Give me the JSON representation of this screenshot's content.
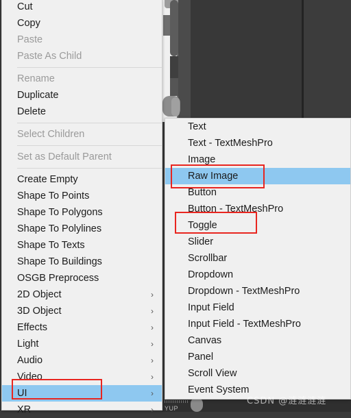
{
  "app": {
    "context": "unity-hierarchy-context-menu",
    "watermark": "CSDN @涟涟涟涟"
  },
  "colors": {
    "menu_background": "#f0f0f0",
    "menu_text": "#1b1b1b",
    "menu_text_disabled": "#9a9a9a",
    "highlight": "#8ec8f0",
    "annotation_red": "#e8251f",
    "editor_background": "#3a3a3a",
    "separator": "#d7d7d7"
  },
  "main_menu": {
    "name": "hierarchy-context-menu",
    "groups": [
      {
        "items": [
          {
            "label": "Cut",
            "enabled": true,
            "submenu": false
          },
          {
            "label": "Copy",
            "enabled": true,
            "submenu": false
          },
          {
            "label": "Paste",
            "enabled": false,
            "submenu": false
          },
          {
            "label": "Paste As Child",
            "enabled": false,
            "submenu": false
          }
        ]
      },
      {
        "items": [
          {
            "label": "Rename",
            "enabled": false,
            "submenu": false
          },
          {
            "label": "Duplicate",
            "enabled": true,
            "submenu": false
          },
          {
            "label": "Delete",
            "enabled": true,
            "submenu": false
          }
        ]
      },
      {
        "items": [
          {
            "label": "Select Children",
            "enabled": false,
            "submenu": false
          }
        ]
      },
      {
        "items": [
          {
            "label": "Set as Default Parent",
            "enabled": false,
            "submenu": false
          }
        ]
      },
      {
        "items": [
          {
            "label": "Create Empty",
            "enabled": true,
            "submenu": false
          },
          {
            "label": "Shape To Points",
            "enabled": true,
            "submenu": false
          },
          {
            "label": "Shape To Polygons",
            "enabled": true,
            "submenu": false
          },
          {
            "label": "Shape To Polylines",
            "enabled": true,
            "submenu": false
          },
          {
            "label": "Shape To Texts",
            "enabled": true,
            "submenu": false
          },
          {
            "label": "Shape To Buildings",
            "enabled": true,
            "submenu": false
          },
          {
            "label": "OSGB Preprocess",
            "enabled": true,
            "submenu": false
          },
          {
            "label": "2D Object",
            "enabled": true,
            "submenu": true
          },
          {
            "label": "3D Object",
            "enabled": true,
            "submenu": true
          },
          {
            "label": "Effects",
            "enabled": true,
            "submenu": true
          },
          {
            "label": "Light",
            "enabled": true,
            "submenu": true
          },
          {
            "label": "Audio",
            "enabled": true,
            "submenu": true
          },
          {
            "label": "Video",
            "enabled": true,
            "submenu": true
          },
          {
            "label": "UI",
            "enabled": true,
            "submenu": true,
            "selected": true
          },
          {
            "label": "XR",
            "enabled": true,
            "submenu": true
          }
        ]
      }
    ]
  },
  "sub_menu": {
    "name": "ui-submenu",
    "items": [
      {
        "label": "Text",
        "selected": false
      },
      {
        "label": "Text - TextMeshPro",
        "selected": false
      },
      {
        "label": "Image",
        "selected": false
      },
      {
        "label": "Raw Image",
        "selected": true
      },
      {
        "label": "Button",
        "selected": false
      },
      {
        "label": "Button - TextMeshPro",
        "selected": false
      },
      {
        "label": "Toggle",
        "selected": false
      },
      {
        "label": "Slider",
        "selected": false
      },
      {
        "label": "Scrollbar",
        "selected": false
      },
      {
        "label": "Dropdown",
        "selected": false
      },
      {
        "label": "Dropdown - TextMeshPro",
        "selected": false
      },
      {
        "label": "Input Field",
        "selected": false
      },
      {
        "label": "Input Field - TextMeshPro",
        "selected": false
      },
      {
        "label": "Canvas",
        "selected": false
      },
      {
        "label": "Panel",
        "selected": false
      },
      {
        "label": "Scroll View",
        "selected": false
      },
      {
        "label": "Event System",
        "selected": false
      }
    ]
  },
  "annotations": [
    {
      "name": "redbox-ui",
      "target": "UI"
    },
    {
      "name": "redbox-rawimage",
      "target": "Raw Image"
    },
    {
      "name": "redbox-toggle",
      "target": "Toggle"
    }
  ],
  "icons": {
    "submenu_arrow": "›"
  },
  "bottom_bar": {
    "label": "YUP"
  }
}
